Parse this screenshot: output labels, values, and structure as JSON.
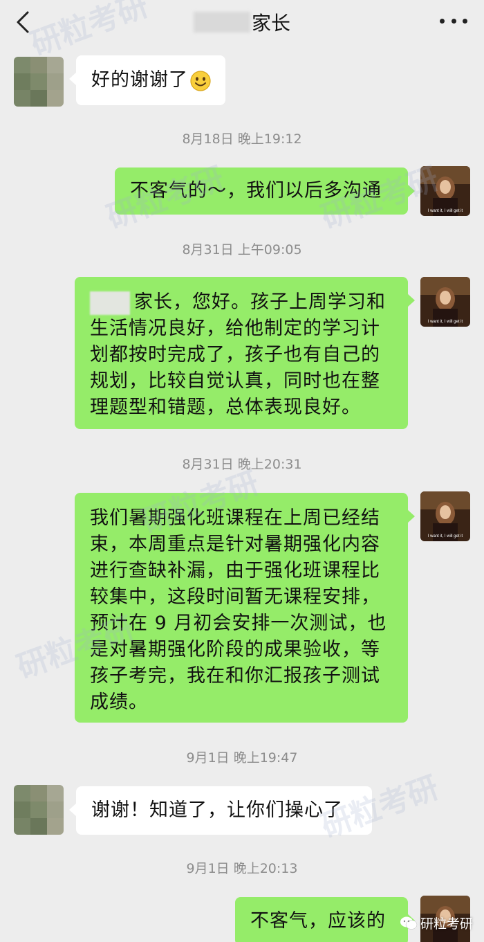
{
  "header": {
    "title_suffix": "家长"
  },
  "messages": [
    {
      "side": "left",
      "text": "好的谢谢了"
    },
    {
      "timestamp": "8月18日 晚上19:12"
    },
    {
      "side": "right",
      "text": "不客气的～，我们以后多沟通"
    },
    {
      "timestamp": "8月31日 上午09:05"
    },
    {
      "side": "right",
      "lines": [
        "家长，您好。孩子上周学习和",
        "生活情况良好，给他制定的学习计",
        "划都按时完成了，孩子也有自己的",
        "规划，比较自觉认真，同时也在整",
        "理题型和错题，总体表现良好。"
      ]
    },
    {
      "timestamp": "8月31日 晚上20:31"
    },
    {
      "side": "right",
      "lines": [
        "我们暑期强化班课程在上周已经结",
        "束，本周重点是针对暑期强化内容",
        "进行查缺补漏，由于强化班课程比",
        "较集中，这段时间暂无课程安排，",
        "预计在 9 月初会安排一次测试，也",
        "是对暑期强化阶段的成果验收，等",
        "孩子考完，我在和你汇报孩子测试",
        "成绩。"
      ]
    },
    {
      "timestamp": "9月1日 晚上19:47"
    },
    {
      "side": "left",
      "text": "谢谢！知道了，让你们操心了"
    },
    {
      "timestamp": "9月1日 晚上20:13"
    },
    {
      "side": "right",
      "text": "不客气，应该的"
    }
  ],
  "avatar_caption": "I want it, I will get it",
  "watermark": {
    "corner_label": "研粒考研",
    "tiles": [
      "研粒考研",
      "研粒考研",
      "研粒考研",
      "研粒考研",
      "研粒考研",
      "研粒考研"
    ]
  },
  "colors": {
    "background": "#ededed",
    "bubble_self": "#95ec69",
    "bubble_other": "#ffffff",
    "timestamp": "#8c8c8c"
  }
}
